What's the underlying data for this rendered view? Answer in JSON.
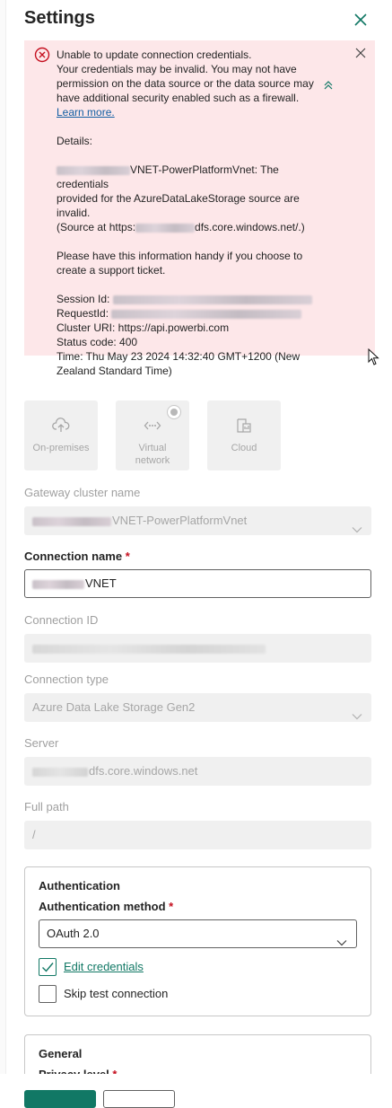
{
  "panel": {
    "title": "Settings"
  },
  "error": {
    "line1": "Unable to update connection credentials.",
    "line2": "Your credentials may be invalid. You may not have permission on the data source or the data source may have additional security enabled such as a firewall.",
    "learn_more": "Learn more.",
    "details_label": "Details:",
    "details_name_suffix": "VNET-PowerPlatformVnet: The credentials",
    "details_line2": "provided for the AzureDataLakeStorage source are invalid.",
    "details_source_prefix": "(Source at https:",
    "details_source_suffix": "dfs.core.windows.net/.)",
    "support_note": "Please have this information handy if you choose to create a support ticket.",
    "session_label": "Session Id:",
    "request_label": "RequestId:",
    "cluster_uri": "Cluster URI: https://api.powerbi.com",
    "status_code": "Status code: 400",
    "time": "Time: Thu May 23 2024 14:32:40 GMT+1200 (New Zealand Standard Time)"
  },
  "tiles": [
    {
      "label": "On-premises"
    },
    {
      "label": "Virtual\nnetwork"
    },
    {
      "label": "Cloud"
    }
  ],
  "form": {
    "gateway_label": "Gateway cluster name",
    "gateway_value_suffix": "VNET-PowerPlatformVnet",
    "conn_name_label": "Connection name",
    "required_mark": "*",
    "conn_name_value_suffix": "VNET",
    "conn_id_label": "Connection ID",
    "conn_type_label": "Connection type",
    "conn_type_value": "Azure Data Lake Storage Gen2",
    "server_label": "Server",
    "server_value_suffix": "dfs.core.windows.net",
    "full_path_label": "Full path",
    "full_path_value": "/"
  },
  "authentication": {
    "heading": "Authentication",
    "method_label": "Authentication method",
    "method_value": "OAuth 2.0",
    "edit_credentials": "Edit credentials",
    "edit_credentials_checked": true,
    "skip_test": "Skip test connection",
    "skip_test_checked": false
  },
  "general": {
    "heading": "General",
    "privacy_label": "Privacy level"
  },
  "colors": {
    "accent": "#117865",
    "error_bg": "#fde7e9",
    "error_icon": "#c50f1f",
    "link": "#115ea3"
  }
}
